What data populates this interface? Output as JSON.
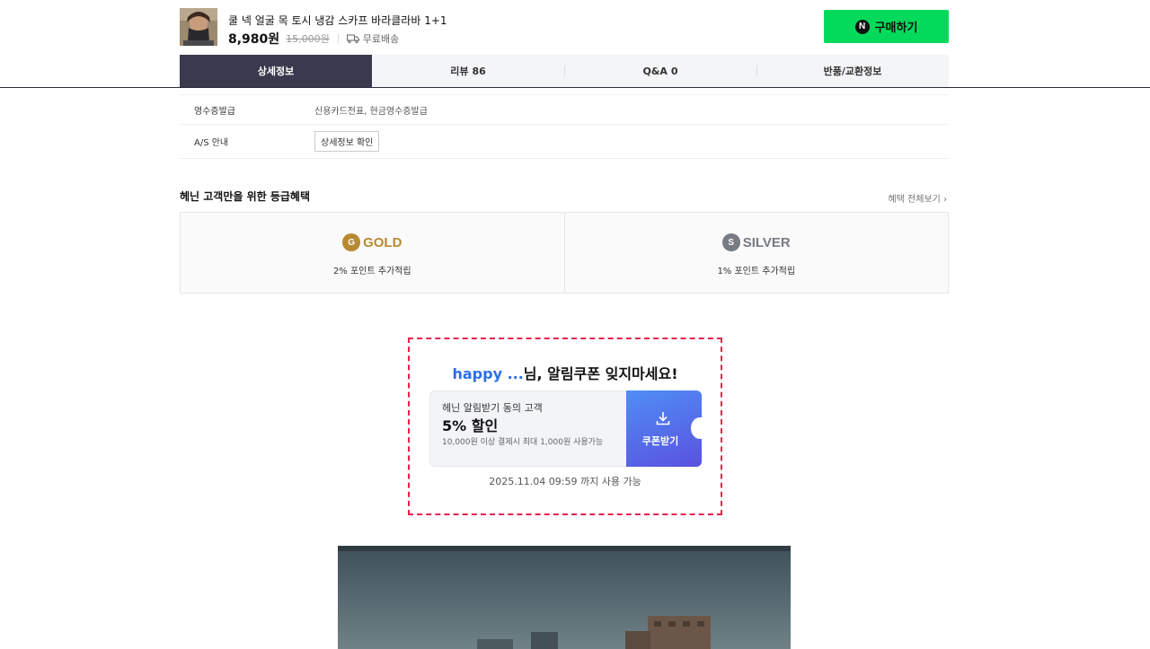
{
  "product": {
    "title": "쿨 넥 얼굴 목 토시 냉감 스카프 바라클라바 1+1",
    "price": "8,980원",
    "original_price": "15,000원",
    "shipping": "무료배송",
    "buy_label": "구매하기",
    "npay_mark": "N"
  },
  "tabs": [
    {
      "label": "상세정보",
      "count": ""
    },
    {
      "label": "리뷰",
      "count": "86"
    },
    {
      "label": "Q&A",
      "count": "0"
    },
    {
      "label": "반품/교환정보",
      "count": ""
    }
  ],
  "info_table": [
    {
      "key": "영수증발급",
      "value": "신용카드전표, 현금영수증발급"
    },
    {
      "key": "A/S 안내",
      "button": "상세정보 확인"
    }
  ],
  "grade": {
    "title": "헤닌 고객만을 위한 등급혜택",
    "link": "혜택 전체보기 ›",
    "items": [
      {
        "badge": "G",
        "name": "GOLD",
        "desc": "2% 포인트 추가적립",
        "color": "#b68a32"
      },
      {
        "badge": "S",
        "name": "SILVER",
        "desc": "1% 포인트 추가적립",
        "color": "#777b82"
      }
    ]
  },
  "coupon": {
    "user": "happy ...",
    "headline_rest": "님, 알림쿠폰 잊지마세요!",
    "target": "헤닌 알림받기 동의 고객",
    "discount": "5% 할인",
    "condition": "10,000원 이상 결제시 최대 1,000원 사용가능",
    "button_label": "쿠폰받기",
    "expire": "2025.11.04 09:59 까지 사용 가능",
    "border_color": "#e8204a"
  },
  "colors": {
    "buy_green": "#03da5b",
    "active_tab": "#3a3a4e",
    "user_blue": "#2c6fe8"
  }
}
